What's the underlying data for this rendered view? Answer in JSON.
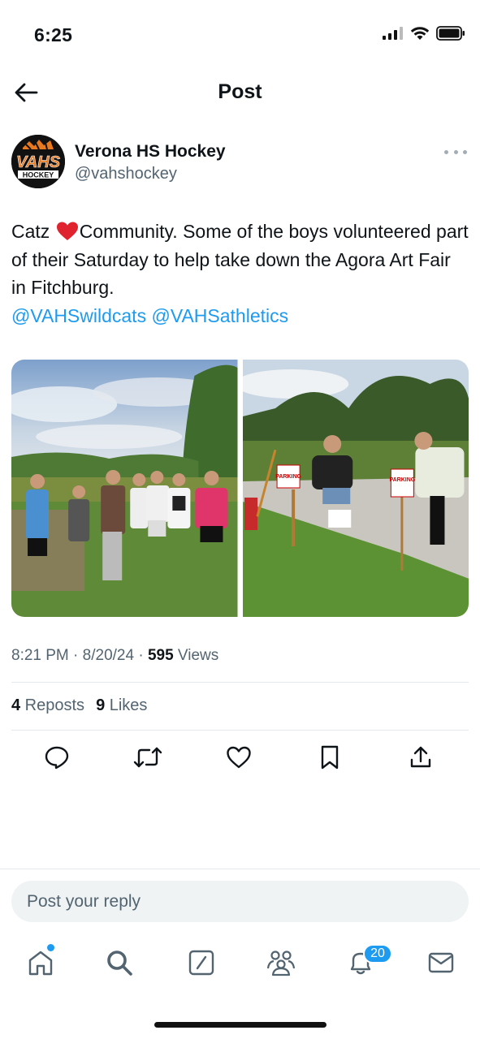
{
  "status_bar": {
    "time": "6:25",
    "signal_icon": "cellular-signal-icon",
    "wifi_icon": "wifi-icon",
    "battery_icon": "battery-icon"
  },
  "header": {
    "title": "Post",
    "back_icon": "back-arrow-icon"
  },
  "author": {
    "name": "Verona HS Hockey",
    "handle": "@vahshockey",
    "avatar_logo_text": "VAHS HOCKEY",
    "more_icon": "more-options-icon"
  },
  "tweet": {
    "text_part1": "Catz ",
    "emoji": "red-heart-emoji",
    "text_part2": "Community.  Some of the boys volunteered part of their Saturday to help take down the Agora Art Fair in Fitchburg.",
    "mention1": "@VAHSwildcats",
    "mention2": "@VAHSathletics"
  },
  "media": [
    {
      "name": "group-photo",
      "description_icon": "photo"
    },
    {
      "name": "parking-signs-photo",
      "description_icon": "photo"
    }
  ],
  "meta": {
    "time": "8:21 PM",
    "sep1": " · ",
    "date": "8/20/24",
    "sep2": " · ",
    "views_count": "595",
    "views_label": " Views"
  },
  "stats": {
    "reposts_count": "4",
    "reposts_label": " Reposts",
    "likes_count": "9",
    "likes_label": " Likes"
  },
  "actions": [
    "reply-icon",
    "repost-icon",
    "like-icon",
    "bookmark-icon",
    "share-icon"
  ],
  "reply": {
    "placeholder": "Post your reply"
  },
  "tabbar": {
    "tabs": [
      "home-icon",
      "search-icon",
      "compose-icon",
      "communities-icon",
      "notifications-icon",
      "messages-icon"
    ],
    "notifications_badge": "20"
  },
  "colors": {
    "accent": "#1d9bf0",
    "text": "#0f1419",
    "secondary": "#536471"
  }
}
